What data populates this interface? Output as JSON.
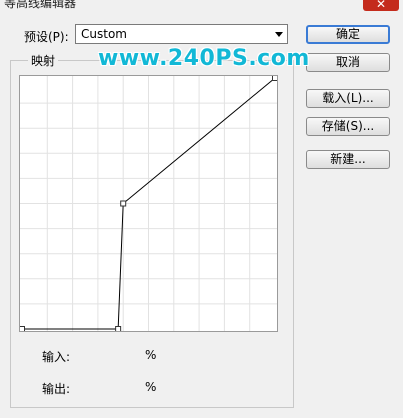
{
  "window": {
    "title": "等高线编辑器",
    "close_glyph": "✕"
  },
  "preset": {
    "label": "预设(P):",
    "value": "Custom"
  },
  "buttons": {
    "ok": "确定",
    "cancel": "取消",
    "load": "载入(L)...",
    "save": "存储(S)...",
    "new": "新建..."
  },
  "mapping": {
    "legend": "映射"
  },
  "curve": {
    "points": [
      [
        0,
        0
      ],
      [
        38,
        0
      ],
      [
        40,
        50
      ],
      [
        100,
        100
      ]
    ],
    "grid_divisions": 10
  },
  "readout": {
    "input_label": "输入:",
    "input_unit": "%",
    "output_label": "输出:",
    "output_unit": "%"
  },
  "watermark": "www.240PS.com"
}
